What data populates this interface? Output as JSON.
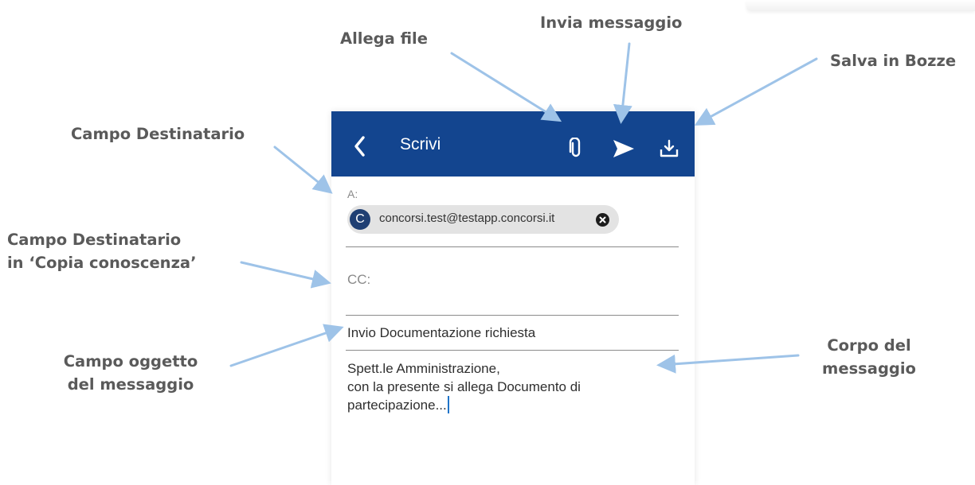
{
  "annotations": {
    "invia_messaggio": "Invia messaggio",
    "allega_file": "Allega file",
    "salva_bozze": "Salva in Bozze",
    "campo_destinatario": "Campo Destinatario",
    "campo_cc_line1": "Campo Destinatario",
    "campo_cc_line2": "in ‘Copia conoscenza’",
    "campo_oggetto_line1": "Campo oggetto",
    "campo_oggetto_line2": "del messaggio",
    "corpo_line1": "Corpo del",
    "corpo_line2": "messaggio"
  },
  "appbar": {
    "title": "Scrivi",
    "background": "#13458f",
    "icons": [
      "back-icon",
      "paperclip-icon",
      "send-icon",
      "download-icon"
    ]
  },
  "compose": {
    "to_label": "A:",
    "recipient": {
      "initial": "C",
      "email": "concorsi.test@testapp.concorsi.it"
    },
    "cc_label": "CC:",
    "subject": "Invio Documentazione richiesta",
    "body_lines": [
      "Spett.le Amministrazione,",
      "con la presente si allega Documento di",
      "partecipazione..."
    ]
  },
  "colors": {
    "accent": "#13458f",
    "annotation_text": "#5a5a5a",
    "arrow": "#9ec3e8"
  }
}
